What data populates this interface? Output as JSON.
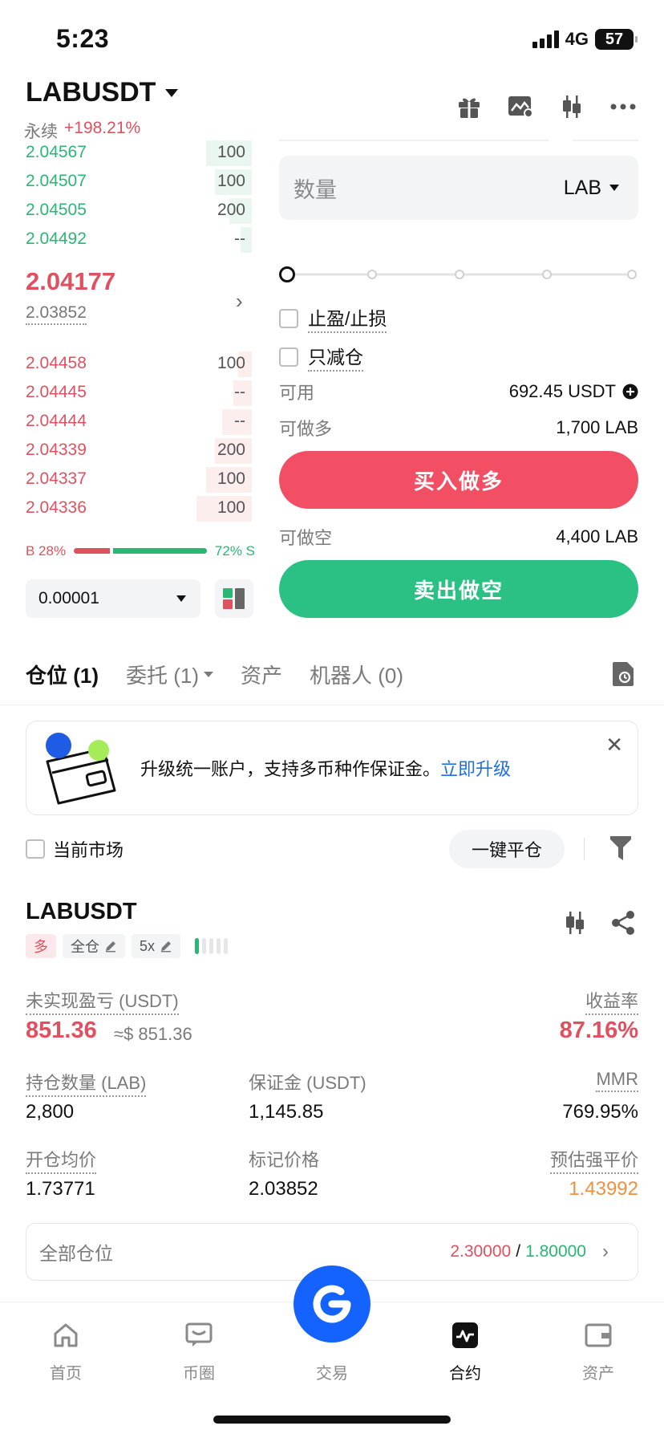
{
  "status": {
    "time": "5:23",
    "network": "4G",
    "battery": "57"
  },
  "header": {
    "pair": "LABUSDT",
    "contract_type": "永续",
    "change": "+198.21%"
  },
  "orderbook": {
    "asks": [
      {
        "price": "2.04567",
        "qty": "100",
        "depth": 0.2
      },
      {
        "price": "2.04507",
        "qty": "100",
        "depth": 0.16
      },
      {
        "price": "2.04505",
        "qty": "200",
        "depth": 0.1
      },
      {
        "price": "2.04492",
        "qty": "--",
        "depth": 0.05
      }
    ],
    "last_price": "2.04177",
    "mark_price": "2.03852",
    "bids": [
      {
        "price": "2.04458",
        "qty": "100",
        "depth": 0.06
      },
      {
        "price": "2.04445",
        "qty": "--",
        "depth": 0.08
      },
      {
        "price": "2.04444",
        "qty": "--",
        "depth": 0.13
      },
      {
        "price": "2.04339",
        "qty": "200",
        "depth": 0.16
      },
      {
        "price": "2.04337",
        "qty": "100",
        "depth": 0.2
      },
      {
        "price": "2.04336",
        "qty": "100",
        "depth": 0.24
      }
    ],
    "ratio": {
      "buy_label": "B 28%",
      "sell_label": "72% S",
      "buy": 0.28
    },
    "precision": "0.00001"
  },
  "form": {
    "qty_placeholder": "数量",
    "qty_unit": "LAB",
    "tp_sl": "止盈/止损",
    "reduce_only": "只减仓",
    "available_label": "可用",
    "available_value": "692.45 USDT",
    "can_long_label": "可做多",
    "can_long_value": "1,700 LAB",
    "buy_button": "买入做多",
    "can_short_label": "可做空",
    "can_short_value": "4,400 LAB",
    "sell_button": "卖出做空"
  },
  "tabs": [
    {
      "label": "仓位 (1)"
    },
    {
      "label": "委托 (1)"
    },
    {
      "label": "资产"
    },
    {
      "label": "机器人 (0)"
    }
  ],
  "banner": {
    "text": "升级统一账户，支持多币种作保证金。",
    "link": "立即升级"
  },
  "filter": {
    "current_market": "当前市场",
    "close_all": "一键平仓"
  },
  "position": {
    "symbol": "LABUSDT",
    "side_tag": "多",
    "margin_tag": "全仓",
    "leverage_tag": "5x",
    "pnl_label": "未实现盈亏 (USDT)",
    "pnl_value": "851.36",
    "pnl_usd": "≈$ 851.36",
    "roe_label": "收益率",
    "roe_value": "87.16%",
    "size_label": "持仓数量 (LAB)",
    "size_value": "2,800",
    "margin_label": "保证金 (USDT)",
    "margin_value": "1,145.85",
    "mmr_label": "MMR",
    "mmr_value": "769.95%",
    "entry_label": "开仓均价",
    "entry_value": "1.73771",
    "mark_label": "标记价格",
    "mark_value": "2.03852",
    "liq_label": "预估强平价",
    "liq_value": "1.43992"
  },
  "all_positions": {
    "label": "全部仓位",
    "value_red": "2.30000",
    "sep": "/",
    "value_green": "1.80000"
  },
  "nav": [
    {
      "label": "首页",
      "icon": "home-icon"
    },
    {
      "label": "币圈",
      "icon": "chat-icon"
    },
    {
      "label": "交易",
      "icon": "trade-icon"
    },
    {
      "label": "合约",
      "icon": "futures-icon"
    },
    {
      "label": "资产",
      "icon": "wallet-icon"
    }
  ],
  "colors": {
    "buy": "#2bb673",
    "sell": "#e0515f",
    "buy_button": "#f24f64",
    "sell_button": "#2cc184",
    "link": "#1f6fe6",
    "fab": "#1463ff",
    "liq": "#f0913d"
  }
}
